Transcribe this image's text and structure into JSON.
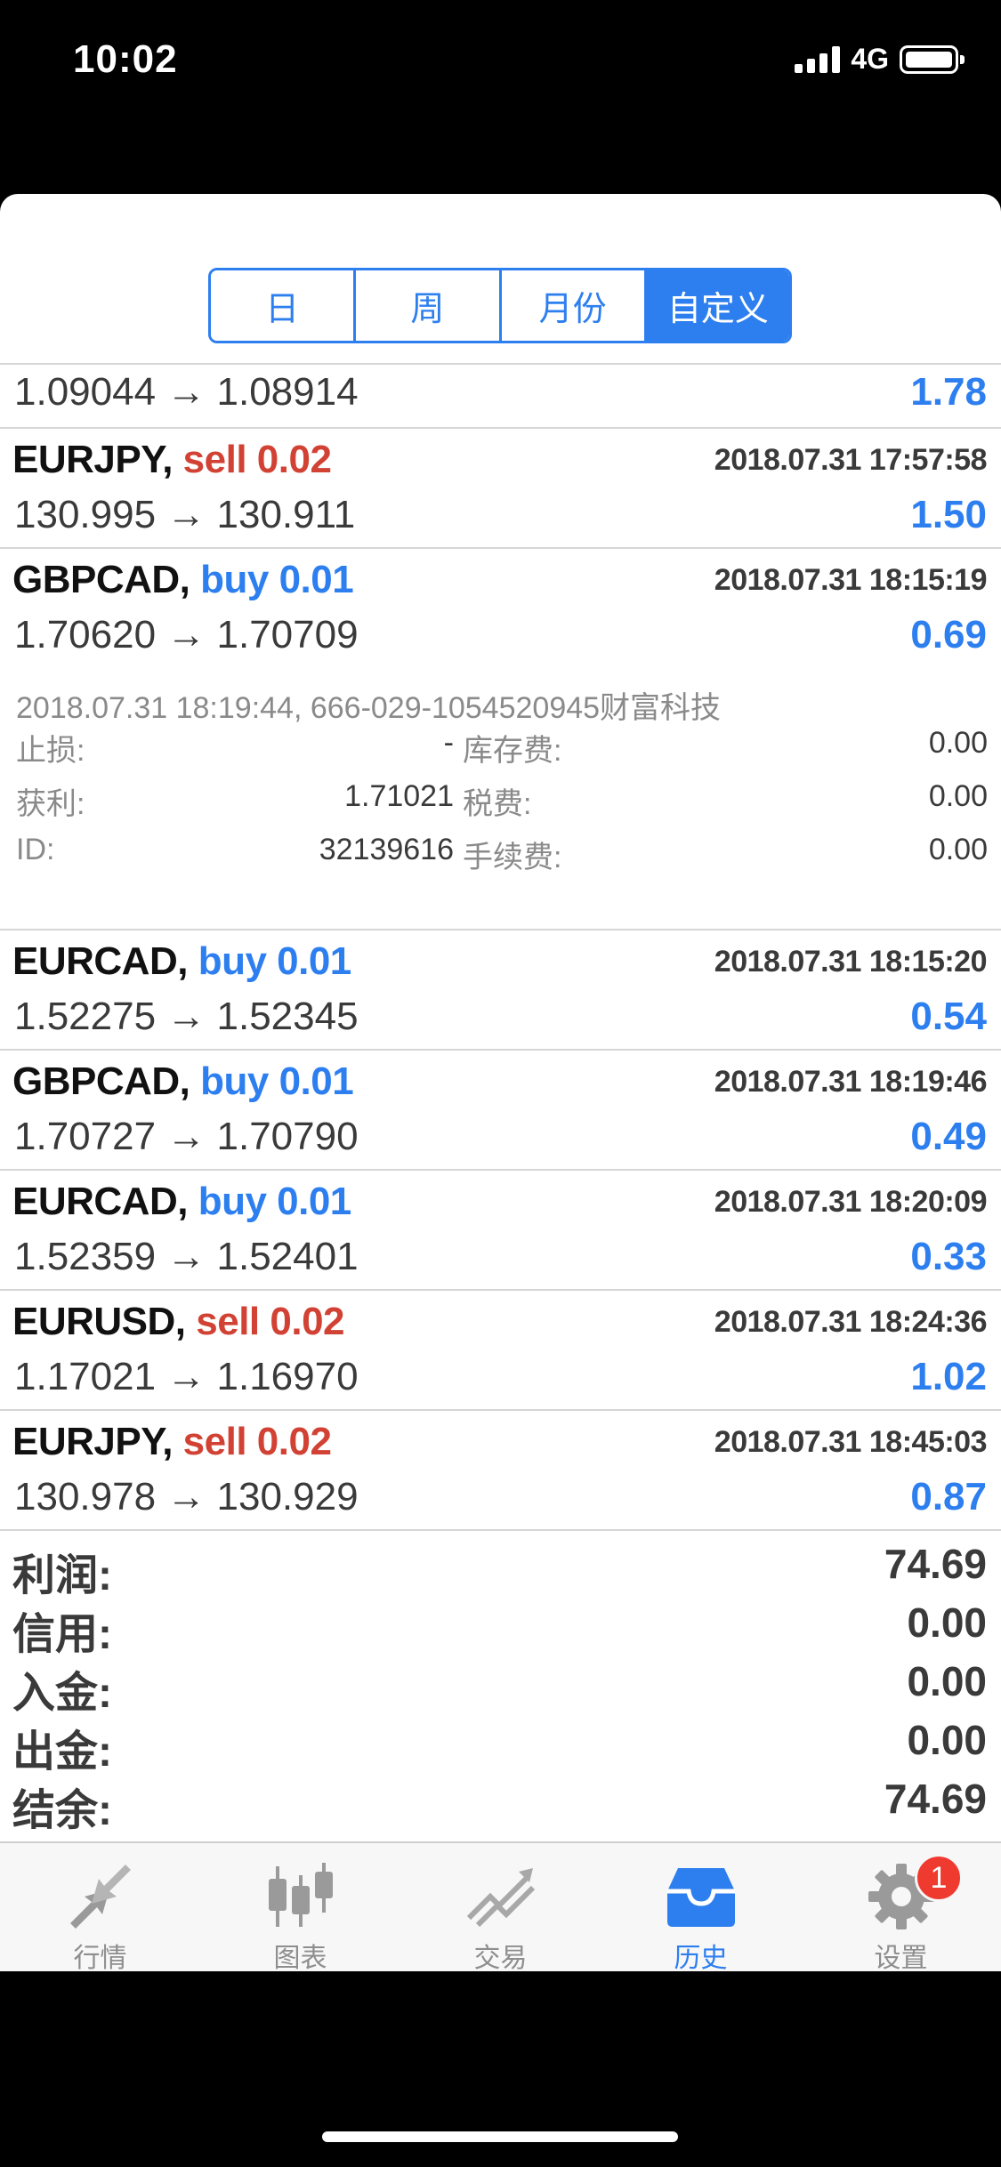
{
  "status_bar": {
    "time": "10:02",
    "network": "4G"
  },
  "period_tabs": [
    {
      "label": "日",
      "active": false
    },
    {
      "label": "周",
      "active": false
    },
    {
      "label": "月份",
      "active": false
    },
    {
      "label": "自定义",
      "active": true
    }
  ],
  "partial_row": {
    "price": "1.09044 → 1.08914",
    "profit": "1.78"
  },
  "trades_before": [
    {
      "symbol": "EURJPY,",
      "side": "sell 0.02",
      "side_type": "sell",
      "time": "2018.07.31 17:57:58",
      "price": "130.995 → 130.911",
      "profit": "1.50"
    },
    {
      "symbol": "GBPCAD,",
      "side": "buy 0.01",
      "side_type": "buy",
      "time": "2018.07.31 18:15:19",
      "price": "1.70620 → 1.70709",
      "profit": "0.69"
    }
  ],
  "details": {
    "header": "2018.07.31 18:19:44, 666-029-1054520945财富科技",
    "rows": [
      {
        "k1": "止损:",
        "v1": "-",
        "k2": "库存费:",
        "v2": "0.00"
      },
      {
        "k1": "获利:",
        "v1": "1.71021",
        "k2": "税费:",
        "v2": "0.00"
      },
      {
        "k1": "ID:",
        "v1": "32139616",
        "k2": "手续费:",
        "v2": "0.00"
      }
    ]
  },
  "trades_after": [
    {
      "symbol": "EURCAD,",
      "side": "buy 0.01",
      "side_type": "buy",
      "time": "2018.07.31 18:15:20",
      "price": "1.52275 → 1.52345",
      "profit": "0.54"
    },
    {
      "symbol": "GBPCAD,",
      "side": "buy 0.01",
      "side_type": "buy",
      "time": "2018.07.31 18:19:46",
      "price": "1.70727 → 1.70790",
      "profit": "0.49"
    },
    {
      "symbol": "EURCAD,",
      "side": "buy 0.01",
      "side_type": "buy",
      "time": "2018.07.31 18:20:09",
      "price": "1.52359 → 1.52401",
      "profit": "0.33"
    },
    {
      "symbol": "EURUSD,",
      "side": "sell 0.02",
      "side_type": "sell",
      "time": "2018.07.31 18:24:36",
      "price": "1.17021 → 1.16970",
      "profit": "1.02"
    },
    {
      "symbol": "EURJPY,",
      "side": "sell 0.02",
      "side_type": "sell",
      "time": "2018.07.31 18:45:03",
      "price": "130.978 → 130.929",
      "profit": "0.87"
    }
  ],
  "summary": [
    {
      "label": "利润:",
      "value": "74.69"
    },
    {
      "label": "信用:",
      "value": "0.00"
    },
    {
      "label": "入金:",
      "value": "0.00"
    },
    {
      "label": "出金:",
      "value": "0.00"
    },
    {
      "label": "结余:",
      "value": "74.69"
    }
  ],
  "tab_bar": [
    {
      "label": "行情",
      "icon": "quotes-arrows-icon",
      "active": false
    },
    {
      "label": "图表",
      "icon": "candlestick-chart-icon",
      "active": false
    },
    {
      "label": "交易",
      "icon": "trade-chart-icon",
      "active": false
    },
    {
      "label": "历史",
      "icon": "history-inbox-icon",
      "active": true
    },
    {
      "label": "设置",
      "icon": "gear-icon",
      "active": false,
      "badge": "1"
    }
  ],
  "colors": {
    "accent": "#2d7ff0",
    "sell": "#d24234",
    "badge": "#ef3a30"
  }
}
